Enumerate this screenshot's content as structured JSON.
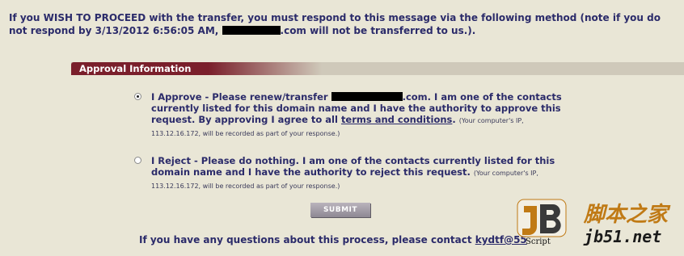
{
  "intro": {
    "part1": "If you WISH TO PROCEED with the transfer, you must respond to this message via the following method (note if you do not respond by 3/13/2012 6:56:05 AM, ",
    "part2": ".com will not be transferred to us.)."
  },
  "section": {
    "title": "Approval  Information"
  },
  "approve": {
    "selected": true,
    "prefix": "I Approve - Please renew/transfer ",
    "middle": ".com. I am one of the contacts currently listed for this domain name and I have the authority to approve this request. By approving I agree to all ",
    "link": "terms and conditions",
    "suffix": ".",
    "note": "(Your computer's IP, 113.12.16.172, will be recorded as part of your response.)"
  },
  "reject": {
    "selected": false,
    "text": "I Reject - Please do nothing. I am one of the contacts currently listed for this domain name and I have the authority to reject this request.",
    "note": "(Your computer's IP, 113.12.16.172, will be recorded as part of your response.)"
  },
  "submit": {
    "label": "SUBMIT"
  },
  "footer": {
    "text": "If you have any questions about this process, please contact ",
    "link": "kydtf@55"
  },
  "watermark": {
    "script_label": "Script",
    "chinese": "脚本之家",
    "url": "jb51.net",
    "colors": {
      "orange": "#c07a15",
      "dark": "#1a1a1a"
    }
  }
}
